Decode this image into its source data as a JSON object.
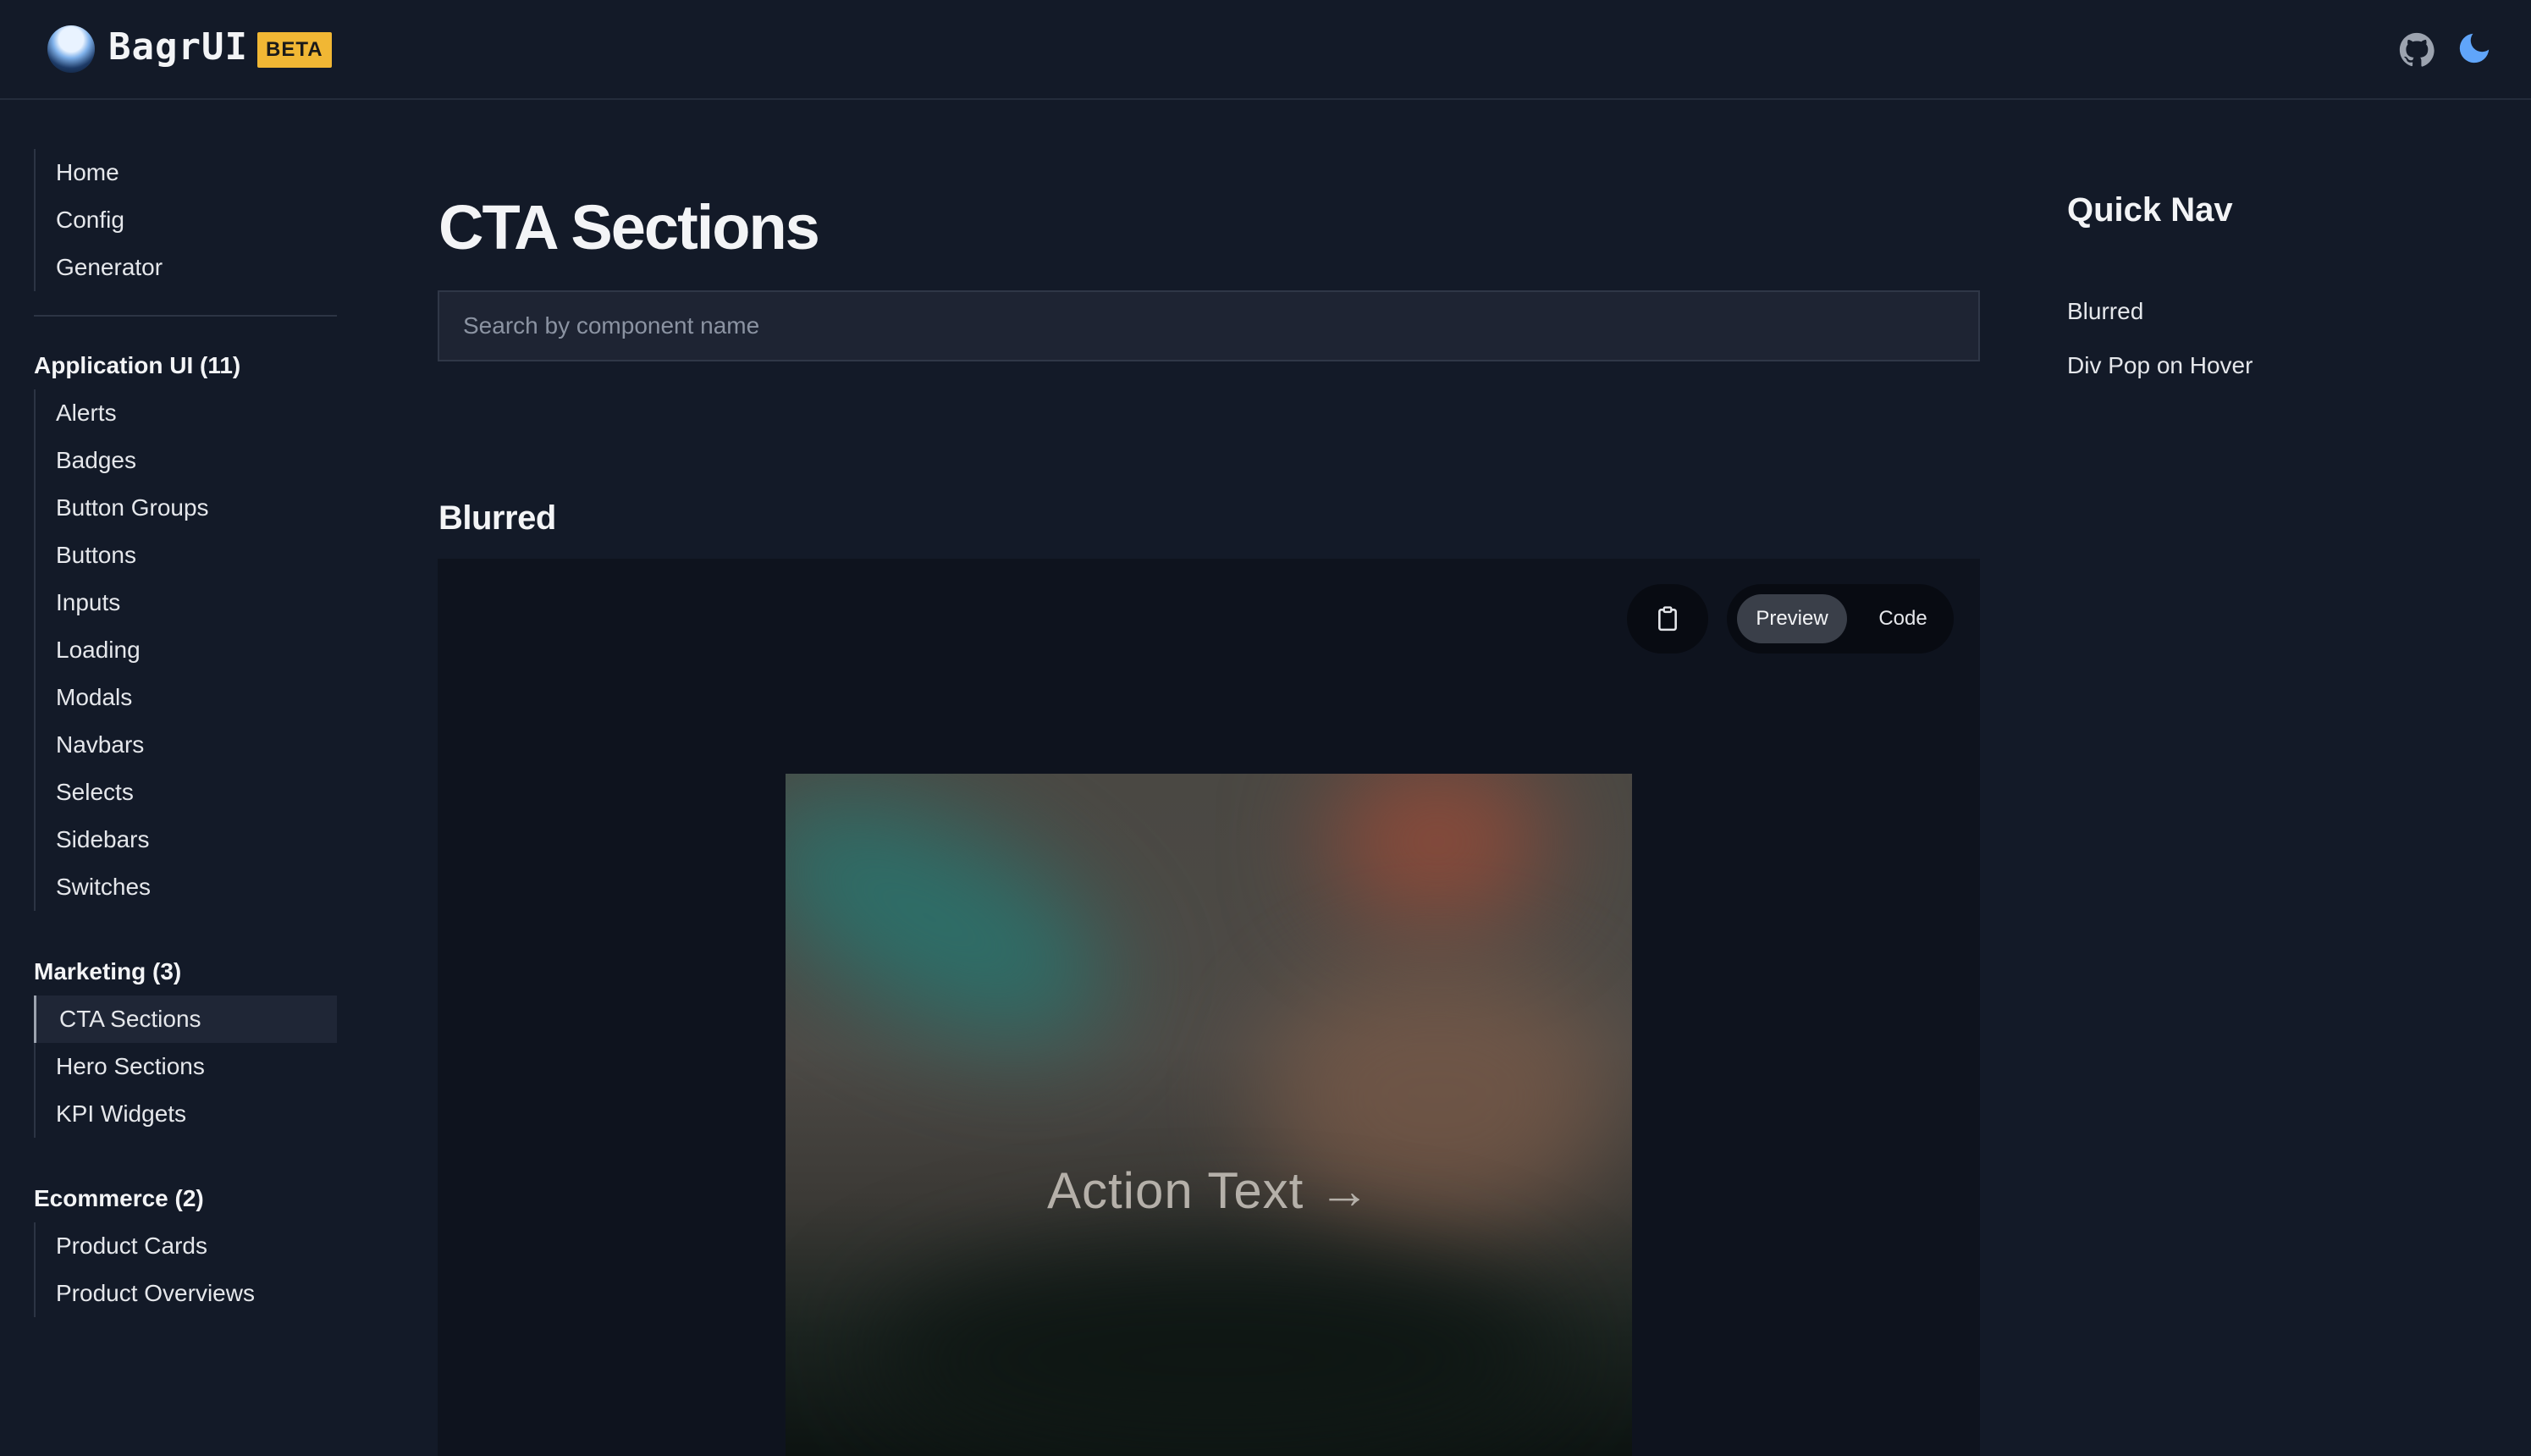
{
  "header": {
    "brand": "BagrUI",
    "badge": "BETA",
    "github_icon": "github-icon",
    "theme_icon": "moon-icon"
  },
  "sidebar": {
    "top_links": [
      "Home",
      "Config",
      "Generator"
    ],
    "groups": [
      {
        "title": "Application UI (11)",
        "items": [
          "Alerts",
          "Badges",
          "Button Groups",
          "Buttons",
          "Inputs",
          "Loading",
          "Modals",
          "Navbars",
          "Selects",
          "Sidebars",
          "Switches"
        ]
      },
      {
        "title": "Marketing (3)",
        "items": [
          "CTA Sections",
          "Hero Sections",
          "KPI Widgets"
        ]
      },
      {
        "title": "Ecommerce (2)",
        "items": [
          "Product Cards",
          "Product Overviews"
        ]
      }
    ],
    "active_item": "CTA Sections"
  },
  "main": {
    "title": "CTA Sections",
    "search_placeholder": "Search by component name",
    "section_title": "Blurred",
    "toolbar": {
      "copy_icon": "clipboard-icon",
      "preview_label": "Preview",
      "code_label": "Code"
    },
    "cta_text": "Action Text →"
  },
  "quick_nav": {
    "title": "Quick Nav",
    "links": [
      "Blurred",
      "Div Pop on Hover"
    ]
  },
  "colors": {
    "background": "#131a28",
    "badge": "#f1b734",
    "moon": "#60a5fa"
  }
}
